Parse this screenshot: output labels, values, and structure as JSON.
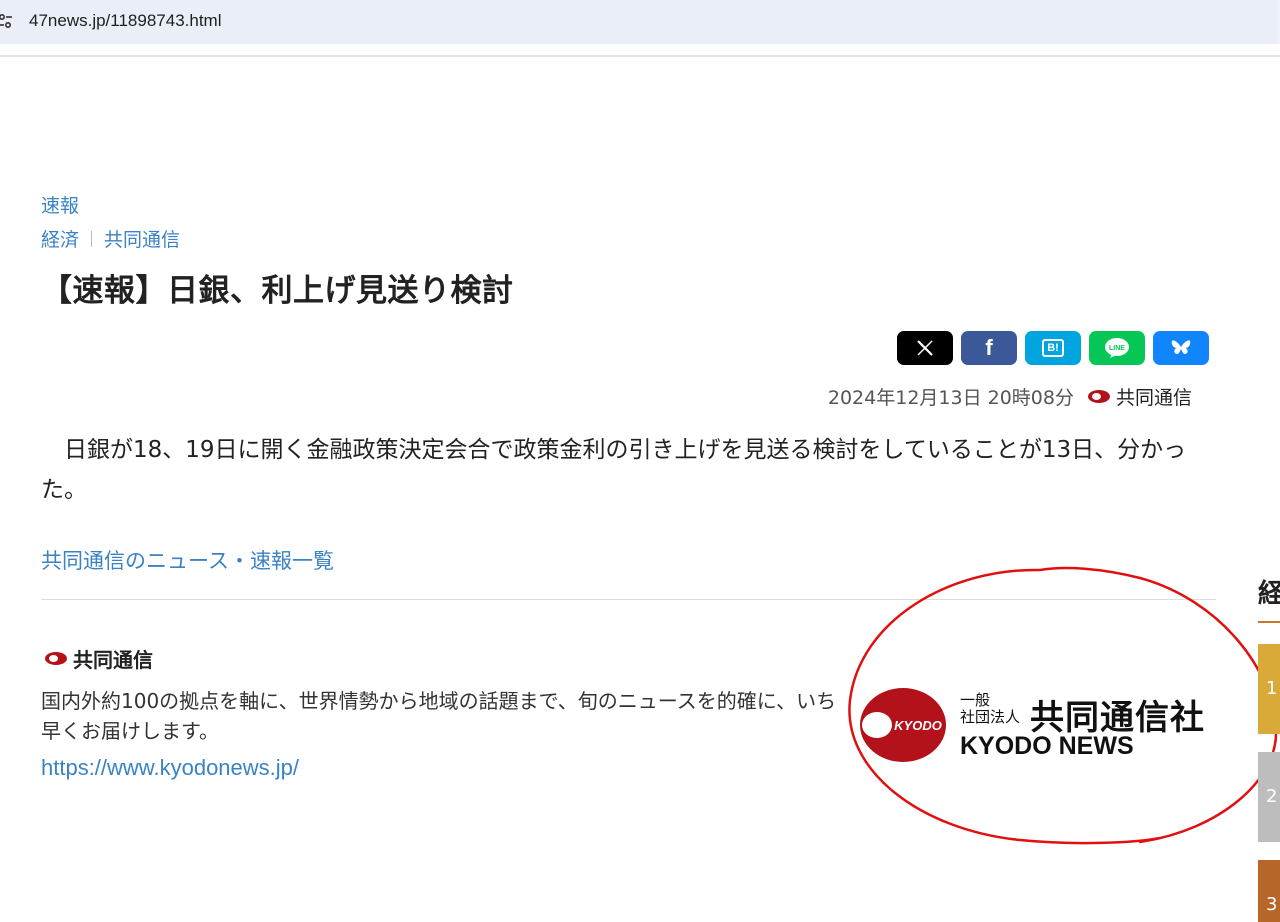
{
  "browser": {
    "url": "47news.jp/11898743.html",
    "site_icon": "tune-icon"
  },
  "article": {
    "category_top": "速報",
    "breadcrumb": [
      "経済",
      "共同通信"
    ],
    "title": "【速報】日銀、利上げ見送り検討",
    "date": "2024年12月13日 20時08分",
    "source": "共同通信",
    "body": "日銀が18、19日に開く金融政策決定会合で政策金利の引き上げを見送る検討をしていることが13日、分かった。",
    "more_link": "共同通信のニュース・速報一覧"
  },
  "share": {
    "buttons": [
      {
        "name": "x",
        "label": "𝕏",
        "color": "#000000"
      },
      {
        "name": "facebook",
        "label": "f",
        "color": "#3b5998"
      },
      {
        "name": "hatena",
        "label": "B!",
        "color": "#00a4de"
      },
      {
        "name": "line",
        "label": "LINE",
        "color": "#06c755"
      },
      {
        "name": "bluesky",
        "label": "bluesky",
        "color": "#1185fe"
      }
    ]
  },
  "provider": {
    "name": "共同通信",
    "description": "国内外約100の拠点を軸に、世界情勢から地域の話題まで、旬のニュースを的確に、いち早くお届けします。",
    "url": "https://www.kyodonews.jp/",
    "logo": {
      "badge": "KYODO",
      "small_line1": "一般",
      "small_line2": "社団法人",
      "name_jp": "共同通信社",
      "name_en": "KYODO NEWS"
    }
  },
  "sidebar": {
    "heading": "経",
    "tiles": [
      {
        "label": "1",
        "color": "#d9a93a"
      },
      {
        "label": "2",
        "color": "#bdbdbd"
      },
      {
        "label": "3",
        "color": "#b8652a"
      }
    ]
  },
  "colors": {
    "link": "#3b82c4",
    "kyodo_red": "#b4121b",
    "annotation": "#e01010"
  }
}
